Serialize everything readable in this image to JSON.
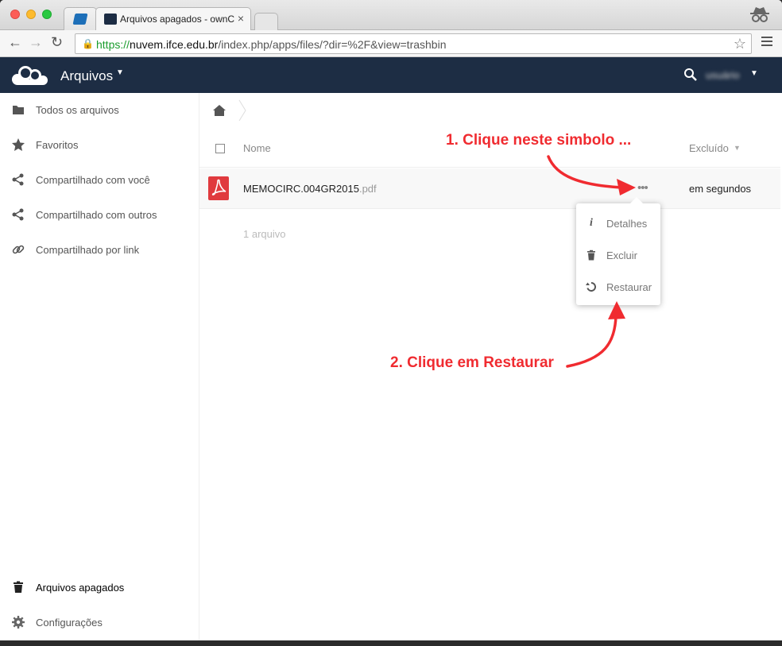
{
  "browser": {
    "tabs": [
      {
        "title": ""
      },
      {
        "title": "Arquivos apagados - ownC"
      }
    ],
    "url_scheme": "https://",
    "url_host": "nuvem.ifce.edu.br",
    "url_path": "/index.php/apps/files/?dir=%2F&view=trashbin"
  },
  "header": {
    "app_title": "Arquivos",
    "username": "usuário"
  },
  "sidebar": {
    "items": [
      {
        "label": "Todos os arquivos",
        "icon": "folder-icon"
      },
      {
        "label": "Favoritos",
        "icon": "star-icon"
      },
      {
        "label": "Compartilhado com você",
        "icon": "share-icon"
      },
      {
        "label": "Compartilhado com outros",
        "icon": "share-icon"
      },
      {
        "label": "Compartilhado por link",
        "icon": "link-icon"
      }
    ],
    "trash_label": "Arquivos apagados",
    "settings_label": "Configurações"
  },
  "table": {
    "col_name": "Nome",
    "col_deleted": "Excluído",
    "rows": [
      {
        "basename": "MEMOCIRC.004GR2015",
        "ext": ".pdf",
        "deleted": "em segundos"
      }
    ],
    "summary": "1 arquivo"
  },
  "popover": {
    "items": [
      {
        "label": "Detalhes",
        "icon": "info-icon"
      },
      {
        "label": "Excluir",
        "icon": "trash-icon"
      },
      {
        "label": "Restaurar",
        "icon": "restore-icon"
      }
    ]
  },
  "annotations": {
    "step1": "1. Clique neste simbolo ...",
    "step2": "2. Clique em Restaurar"
  },
  "colors": {
    "header_bg": "#1d2d44",
    "annotation_red": "#f02b30",
    "secure_green": "#1a9c2d",
    "pdf_red": "#e03a3e"
  }
}
